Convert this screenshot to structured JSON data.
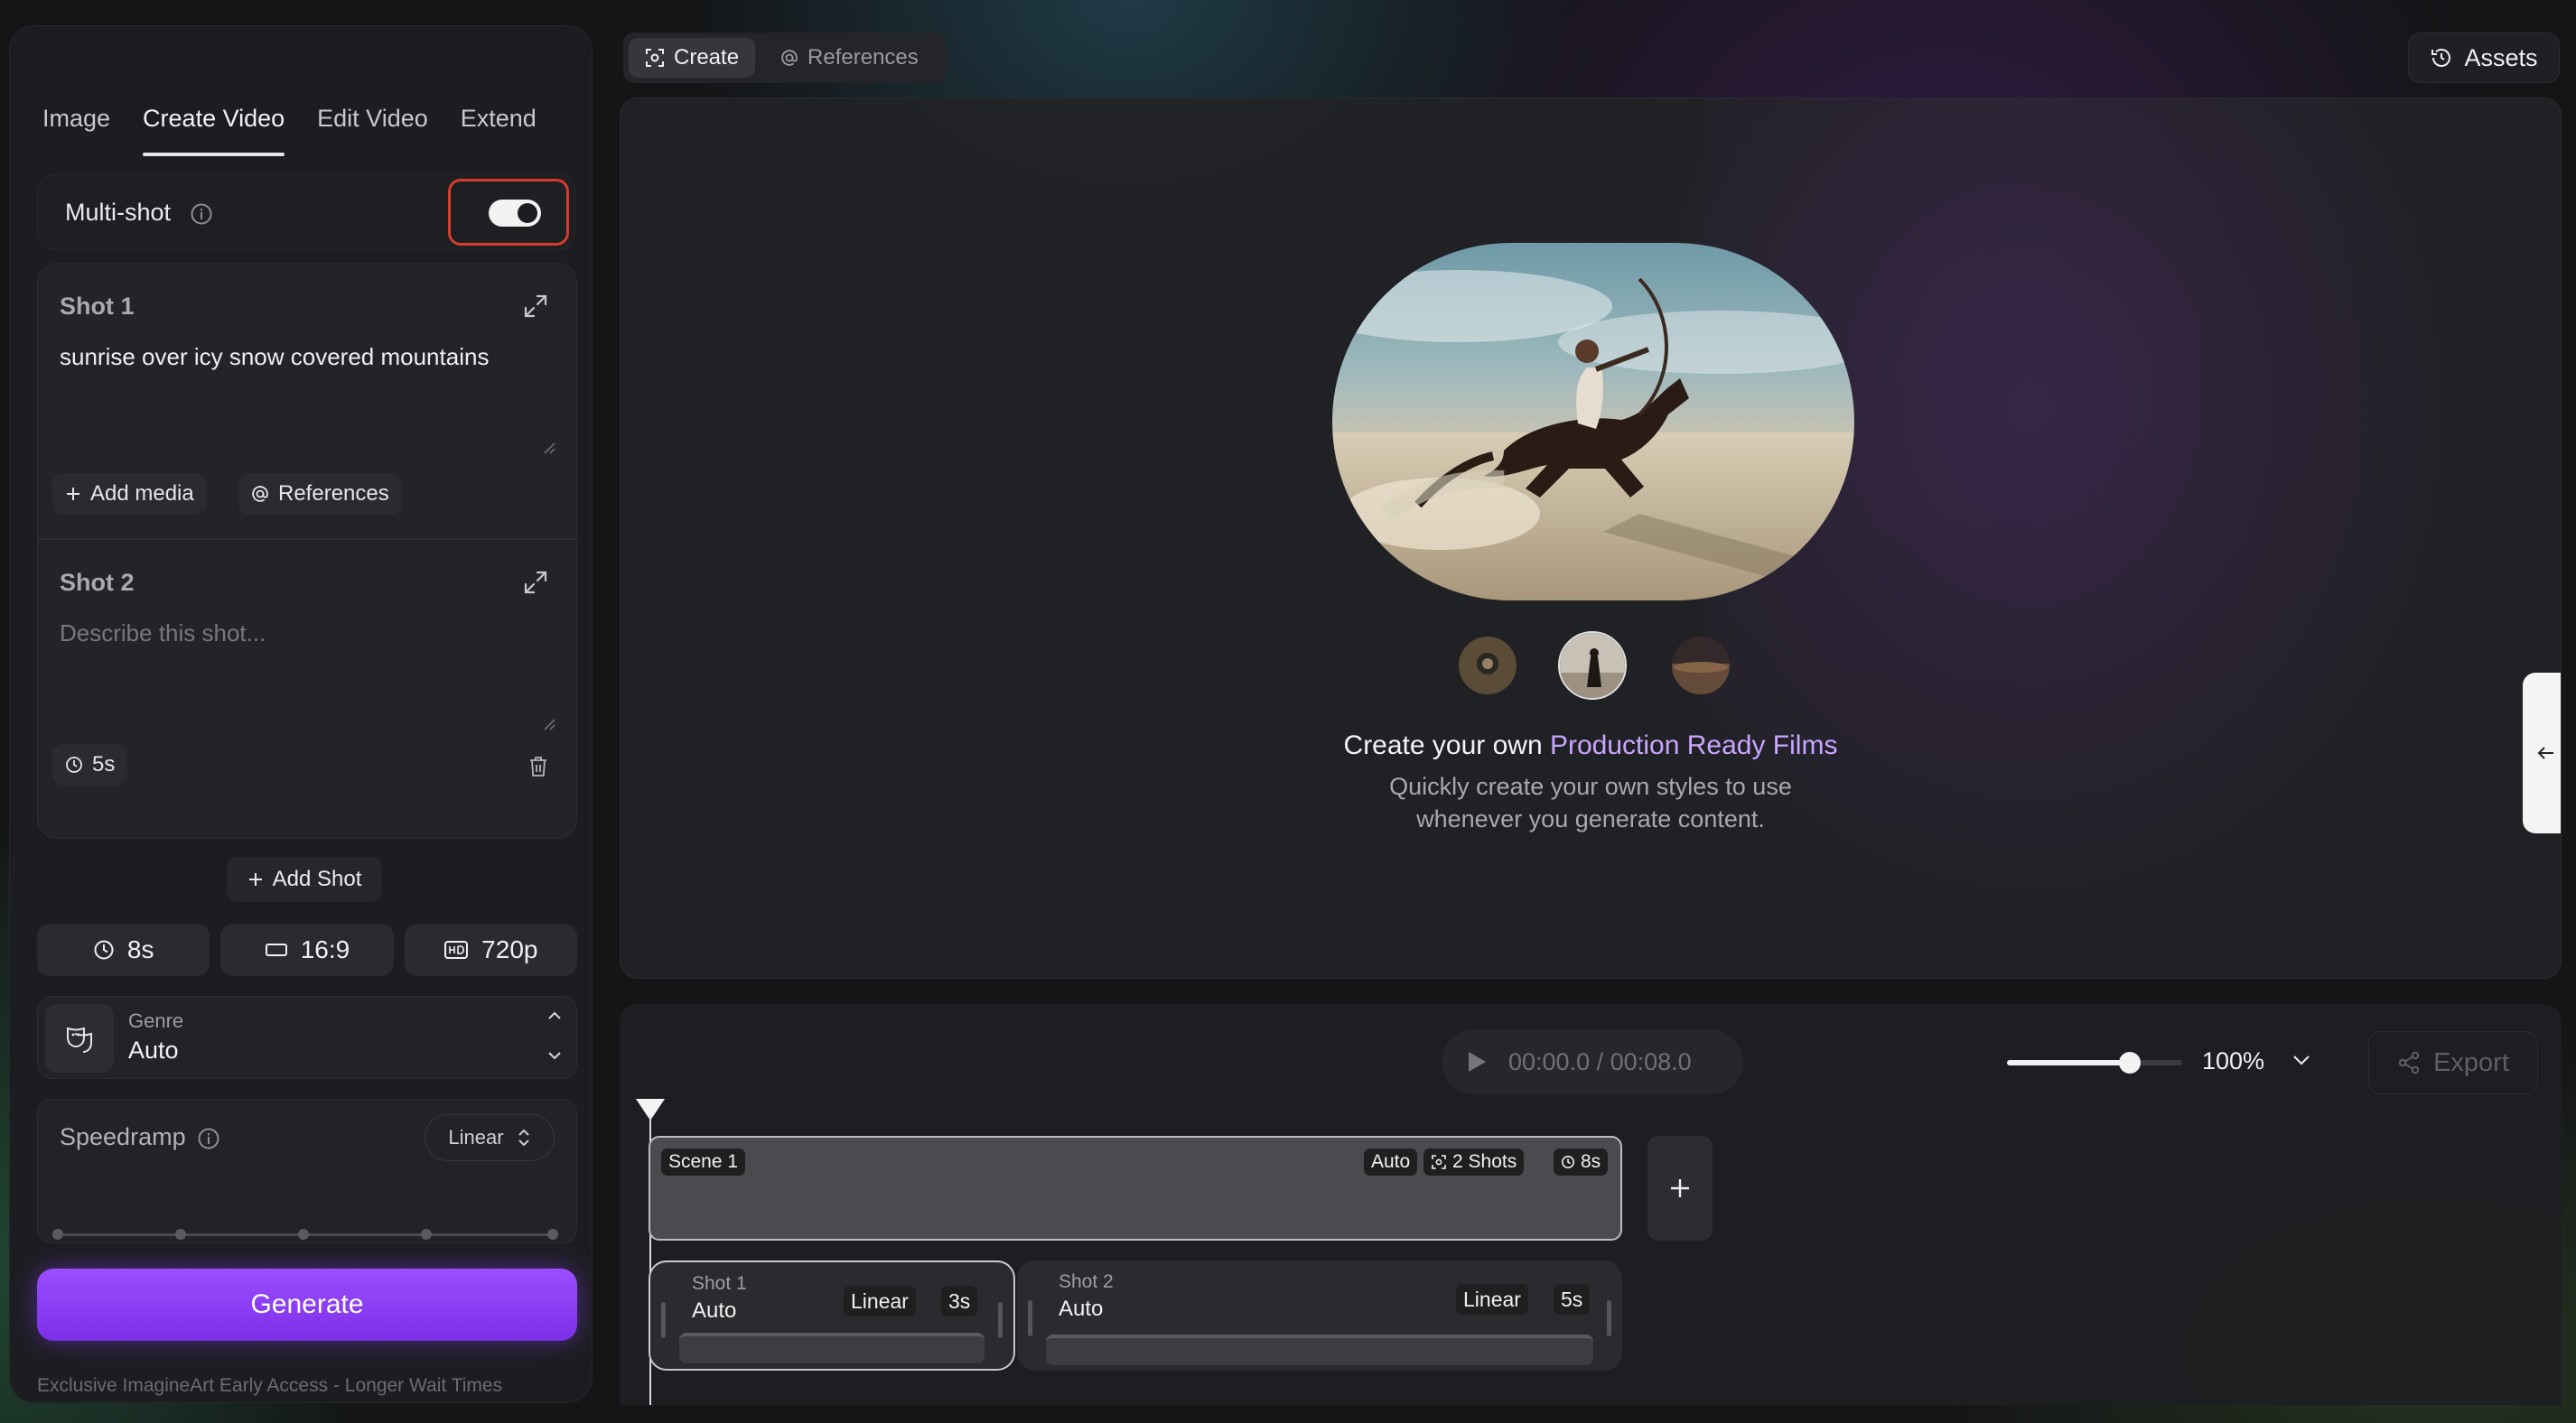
{
  "sidebar": {
    "tabs": [
      {
        "label": "Image"
      },
      {
        "label": "Create Video"
      },
      {
        "label": "Edit Video"
      },
      {
        "label": "Extend"
      }
    ],
    "active_tab": "Create Video",
    "multishot": {
      "label": "Multi-shot",
      "enabled": true
    },
    "shots": [
      {
        "title": "Shot 1",
        "prompt": "sunrise over icy snow covered mountains",
        "add_media_label": "Add media",
        "references_label": "References"
      },
      {
        "title": "Shot 2",
        "placeholder": "Describe this shot...",
        "duration": "5s"
      }
    ],
    "add_shot_label": "Add Shot",
    "params": {
      "duration": "8s",
      "aspect": "16:9",
      "resolution": "720p"
    },
    "genre": {
      "label": "Genre",
      "value": "Auto"
    },
    "speedramp": {
      "label": "Speedramp",
      "mode": "Linear"
    },
    "generate_label": "Generate",
    "footnote": "Exclusive ImagineArt Early Access - Longer Wait Times"
  },
  "topbar": {
    "tabs": [
      {
        "label": "Create"
      },
      {
        "label": "References"
      }
    ],
    "assets_label": "Assets"
  },
  "preview": {
    "headline_prefix": "Create your own ",
    "headline_accent": "Production Ready Films",
    "subline_1": "Quickly create your own styles to use",
    "subline_2": "whenever you generate content."
  },
  "timeline": {
    "time_display": "00:00.0 / 00:08.0",
    "zoom": "100%",
    "zoom_fraction": 0.7,
    "export_label": "Export",
    "scene": {
      "name": "Scene 1",
      "mode": "Auto",
      "shots": "2 Shots",
      "duration": "8s"
    },
    "shot_blocks": [
      {
        "name": "Shot 1",
        "mode": "Auto",
        "ramp": "Linear",
        "duration": "3s"
      },
      {
        "name": "Shot 2",
        "mode": "Auto",
        "ramp": "Linear",
        "duration": "5s"
      }
    ]
  },
  "colors": {
    "accent": "#8b3dff",
    "highlight_outline": "#d93a2b",
    "headline_accent": "#c9a6ff"
  },
  "icons": [
    "info-icon",
    "expand-icon",
    "plus-icon",
    "at-icon",
    "clock-icon",
    "trash-icon",
    "aspect-icon",
    "hd-icon",
    "genre-mask-icon",
    "chevron-up-icon",
    "chevron-down-icon",
    "history-icon",
    "play-icon",
    "share-icon",
    "arrow-left-icon",
    "focus-icon"
  ]
}
